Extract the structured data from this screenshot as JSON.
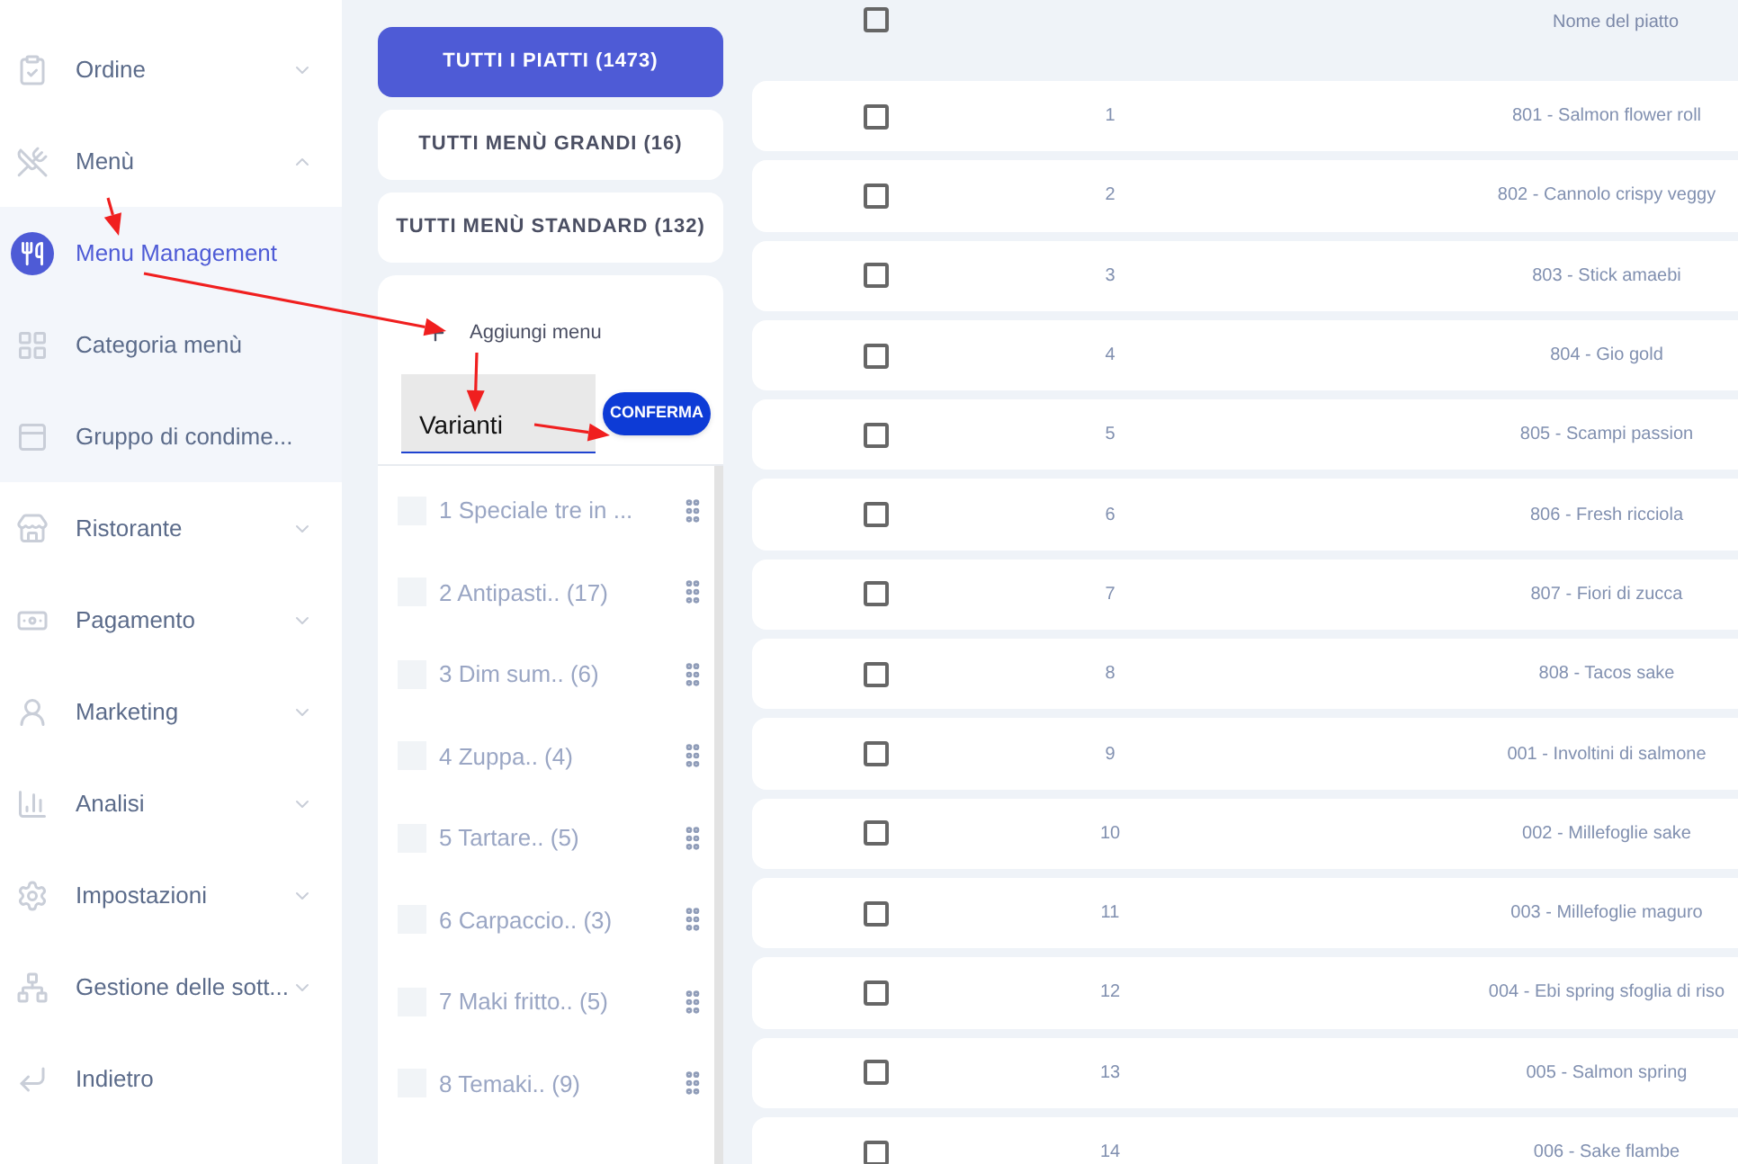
{
  "sidebar": {
    "items": [
      {
        "kind": "group",
        "label": "Ordine",
        "expanded": false
      },
      {
        "kind": "group",
        "label": "Menù",
        "expanded": true,
        "children": [
          {
            "label": "Menu Management",
            "selected": true
          },
          {
            "label": "Categoria menù",
            "selected": false
          },
          {
            "label": "Gruppo di condime...",
            "selected": false
          }
        ]
      },
      {
        "kind": "group",
        "label": "Ristorante",
        "expanded": false
      },
      {
        "kind": "group",
        "label": "Pagamento",
        "expanded": false
      },
      {
        "kind": "group",
        "label": "Marketing",
        "expanded": false
      },
      {
        "kind": "group",
        "label": "Analisi",
        "expanded": false
      },
      {
        "kind": "group",
        "label": "Impostazioni",
        "expanded": false
      },
      {
        "kind": "group",
        "label": "Gestione delle sott...",
        "expanded": false
      },
      {
        "kind": "link",
        "label": "Indietro"
      }
    ]
  },
  "category_buttons": [
    {
      "label": "TUTTI I PIATTI (1473)",
      "selected": true
    },
    {
      "label": "TUTTI MENÙ GRANDI (16)",
      "selected": false
    },
    {
      "label": "TUTTI MENÙ STANDARD (132)",
      "selected": false
    }
  ],
  "add_menu": {
    "label": "Aggiungi menu",
    "input_value": "Varianti",
    "confirm": "CONFERMA"
  },
  "menus": [
    {
      "label": "1 Speciale tre in ...",
      "checked": false
    },
    {
      "label": "2 Antipasti.. (17)",
      "checked": false
    },
    {
      "label": "3 Dim sum.. (6)",
      "checked": false
    },
    {
      "label": "4 Zuppa.. (4)",
      "checked": false
    },
    {
      "label": "5 Tartare.. (5)",
      "checked": false
    },
    {
      "label": "6 Carpaccio.. (3)",
      "checked": false
    },
    {
      "label": "7 Maki fritto.. (5)",
      "checked": false
    },
    {
      "label": "8 Temaki.. (9)",
      "checked": false
    }
  ],
  "table": {
    "header": {
      "checked": false,
      "name_column": "Nome del piatto"
    },
    "rows": [
      {
        "index": "1",
        "name": "801 - Salmon flower roll",
        "checked": false
      },
      {
        "index": "2",
        "name": "802 - Cannolo crispy veggy",
        "checked": false
      },
      {
        "index": "3",
        "name": "803 - Stick amaebi",
        "checked": false
      },
      {
        "index": "4",
        "name": "804 - Gio gold",
        "checked": false
      },
      {
        "index": "5",
        "name": "805 - Scampi passion",
        "checked": false
      },
      {
        "index": "6",
        "name": "806 - Fresh ricciola",
        "checked": false
      },
      {
        "index": "7",
        "name": "807 - Fiori di zucca",
        "checked": false
      },
      {
        "index": "8",
        "name": "808 - Tacos sake",
        "checked": false
      },
      {
        "index": "9",
        "name": "001 - Involtini di salmone",
        "checked": false
      },
      {
        "index": "10",
        "name": "002 - Millefoglie sake",
        "checked": false
      },
      {
        "index": "11",
        "name": "003 - Millefoglie maguro",
        "checked": false
      },
      {
        "index": "12",
        "name": "004 - Ebi spring sfoglia di riso",
        "checked": false
      },
      {
        "index": "13",
        "name": "005 - Salmon spring",
        "checked": false
      },
      {
        "index": "14",
        "name": "006 - Sake flambe",
        "checked": false
      }
    ]
  }
}
